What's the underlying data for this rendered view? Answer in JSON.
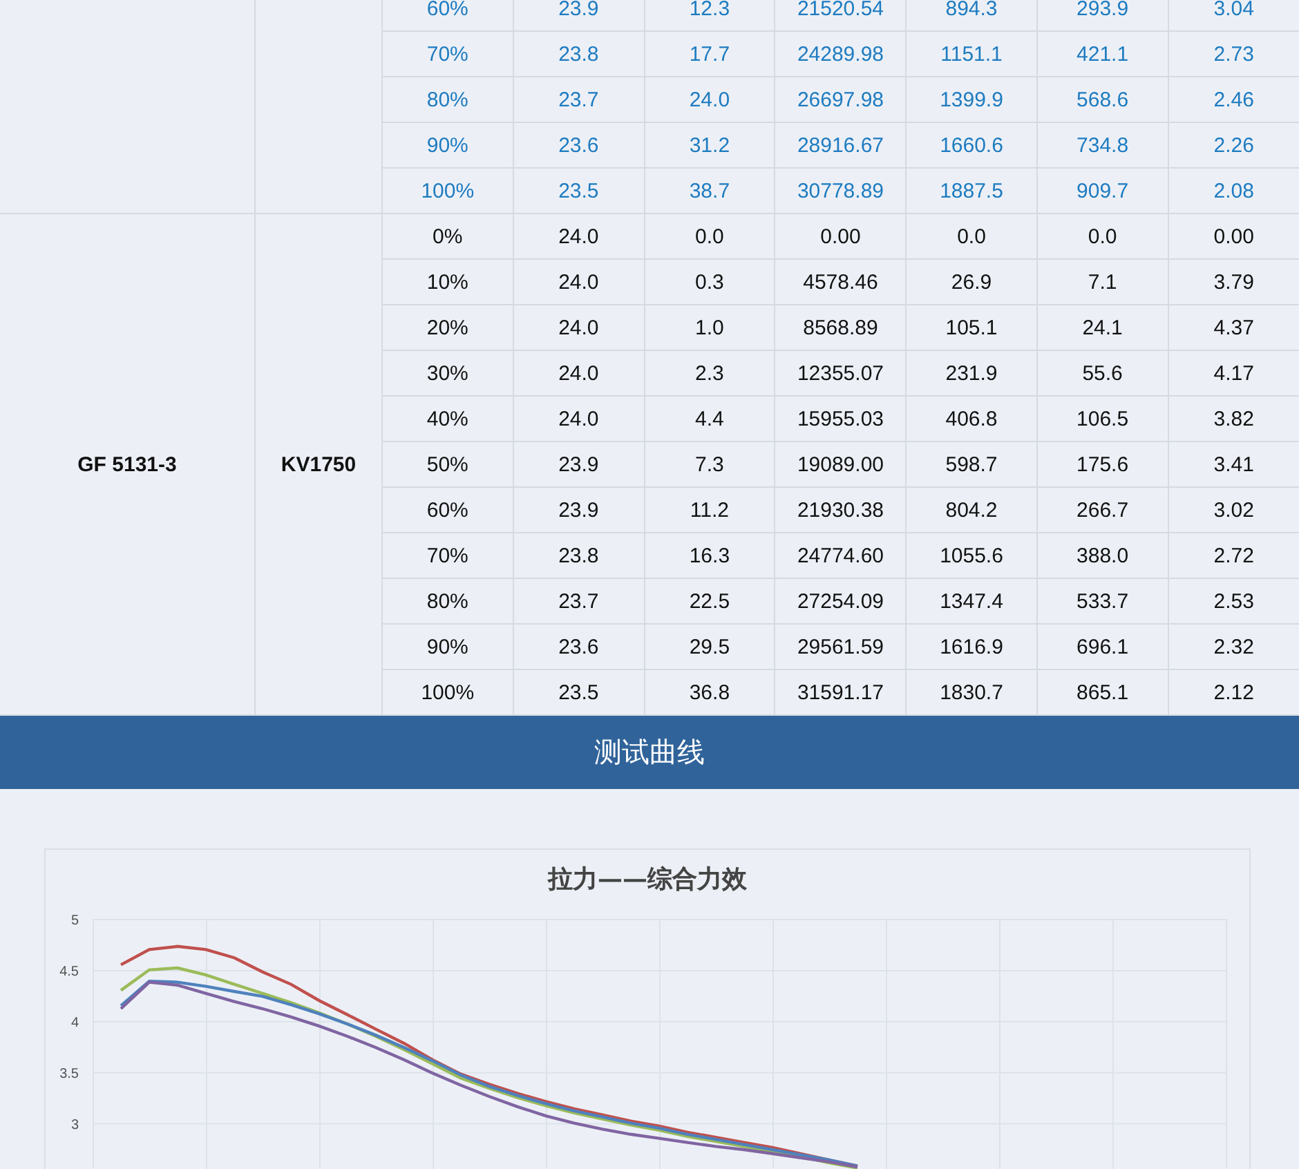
{
  "table": {
    "groups": [
      {
        "color": "#1e7bc0",
        "rows": [
          [
            "60%",
            "23.9",
            "12.3",
            "21520.54",
            "894.3",
            "293.9",
            "3.04"
          ],
          [
            "70%",
            "23.8",
            "17.7",
            "24289.98",
            "1151.1",
            "421.1",
            "2.73"
          ],
          [
            "80%",
            "23.7",
            "24.0",
            "26697.98",
            "1399.9",
            "568.6",
            "2.46"
          ],
          [
            "90%",
            "23.6",
            "31.2",
            "28916.67",
            "1660.6",
            "734.8",
            "2.26"
          ],
          [
            "100%",
            "23.5",
            "38.7",
            "30778.89",
            "1887.5",
            "909.7",
            "2.08"
          ]
        ]
      },
      {
        "color": "#111111",
        "name": "GF 5131-3",
        "model": "KV1750",
        "rows": [
          [
            "0%",
            "24.0",
            "0.0",
            "0.00",
            "0.0",
            "0.0",
            "0.00"
          ],
          [
            "10%",
            "24.0",
            "0.3",
            "4578.46",
            "26.9",
            "7.1",
            "3.79"
          ],
          [
            "20%",
            "24.0",
            "1.0",
            "8568.89",
            "105.1",
            "24.1",
            "4.37"
          ],
          [
            "30%",
            "24.0",
            "2.3",
            "12355.07",
            "231.9",
            "55.6",
            "4.17"
          ],
          [
            "40%",
            "24.0",
            "4.4",
            "15955.03",
            "406.8",
            "106.5",
            "3.82"
          ],
          [
            "50%",
            "23.9",
            "7.3",
            "19089.00",
            "598.7",
            "175.6",
            "3.41"
          ],
          [
            "60%",
            "23.9",
            "11.2",
            "21930.38",
            "804.2",
            "266.7",
            "3.02"
          ],
          [
            "70%",
            "23.8",
            "16.3",
            "24774.60",
            "1055.6",
            "388.0",
            "2.72"
          ],
          [
            "80%",
            "23.7",
            "22.5",
            "27254.09",
            "1347.4",
            "533.7",
            "2.53"
          ],
          [
            "90%",
            "23.6",
            "29.5",
            "29561.59",
            "1616.9",
            "696.1",
            "2.32"
          ],
          [
            "100%",
            "23.5",
            "36.8",
            "31591.17",
            "1830.7",
            "865.1",
            "2.12"
          ]
        ]
      }
    ]
  },
  "section_title": "测试曲线",
  "chart_data": {
    "type": "line",
    "title": "拉力——综合力效",
    "categories": [
      null,
      null,
      null,
      null,
      null,
      null,
      null,
      null,
      null,
      null,
      null,
      null,
      null,
      null,
      null,
      null,
      null,
      null,
      null,
      null,
      null,
      null,
      null,
      null,
      null,
      null,
      null,
      null,
      null,
      null,
      null,
      null,
      null,
      null,
      null,
      null,
      null,
      null,
      null,
      null,
      null
    ],
    "ylim": [
      2.55,
      5
    ],
    "grid": true,
    "yticks": [
      {
        "value": 5,
        "label": "5"
      },
      {
        "value": 4.5,
        "label": "4.5"
      },
      {
        "value": 4,
        "label": "4"
      },
      {
        "value": 3.5,
        "label": "3.5"
      },
      {
        "value": 3,
        "label": "3"
      }
    ],
    "series": [
      {
        "color": "#c0504d",
        "values": [
          null,
          4.55,
          4.7,
          4.73,
          4.7,
          4.62,
          4.48,
          4.36,
          4.2,
          4.06,
          3.92,
          3.78,
          3.62,
          3.48,
          3.38,
          3.29,
          3.21,
          3.14,
          3.08,
          3.02,
          2.97,
          2.91,
          2.86,
          2.81,
          2.76,
          2.7,
          2.64,
          2.58,
          null,
          null,
          null,
          null,
          null,
          null,
          null,
          null,
          null,
          null,
          null,
          null,
          null
        ]
      },
      {
        "color": "#9bbb59",
        "values": [
          null,
          4.3,
          4.5,
          4.52,
          4.45,
          4.36,
          4.27,
          4.18,
          4.08,
          3.97,
          3.85,
          3.72,
          3.58,
          3.44,
          3.34,
          3.25,
          3.17,
          3.1,
          3.04,
          2.98,
          2.93,
          2.87,
          2.82,
          2.77,
          2.72,
          2.67,
          2.61,
          2.56,
          null,
          null,
          null,
          null,
          null,
          null,
          null,
          null,
          null,
          null,
          null,
          null,
          null
        ]
      },
      {
        "color": "#4f81bd",
        "values": [
          null,
          4.15,
          4.39,
          4.38,
          4.34,
          4.29,
          4.24,
          4.16,
          4.07,
          3.97,
          3.86,
          3.74,
          3.61,
          3.47,
          3.36,
          3.27,
          3.19,
          3.12,
          3.06,
          3.0,
          2.95,
          2.89,
          2.84,
          2.79,
          2.74,
          2.69,
          2.64,
          2.58,
          null,
          null,
          null,
          null,
          null,
          null,
          null,
          null,
          null,
          null,
          null,
          null,
          null
        ]
      },
      {
        "color": "#8064a2",
        "values": [
          null,
          4.12,
          4.38,
          4.35,
          4.27,
          4.19,
          4.12,
          4.04,
          3.95,
          3.85,
          3.74,
          3.62,
          3.49,
          3.37,
          3.26,
          3.16,
          3.07,
          3.0,
          2.94,
          2.89,
          2.85,
          2.81,
          2.77,
          2.74,
          2.7,
          2.66,
          2.62,
          2.57,
          null,
          null,
          null,
          null,
          null,
          null,
          null,
          null,
          null,
          null,
          null,
          null,
          null
        ]
      }
    ]
  }
}
